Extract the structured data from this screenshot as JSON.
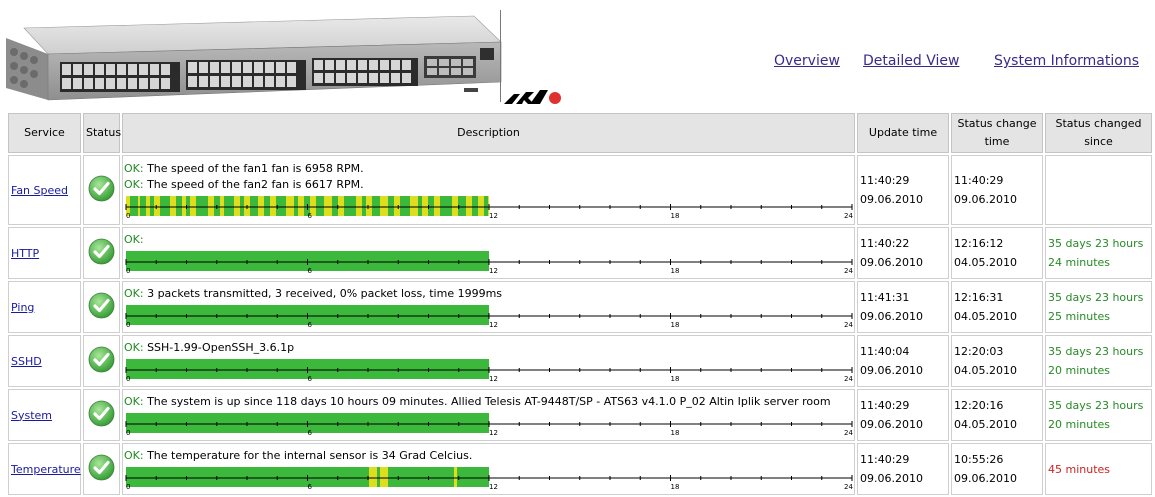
{
  "nav": {
    "overview": "Overview",
    "detailed": "Detailed View",
    "sysinfo": "System Informations"
  },
  "table": {
    "headers": {
      "service": "Service",
      "status": "Status",
      "description": "Description",
      "update": "Update time",
      "change": "Status change time",
      "since": "Status changed since"
    },
    "axis_labels": [
      "0",
      "6",
      "12",
      "18",
      "24"
    ],
    "rows": [
      {
        "service": "Fan Speed",
        "status": "OK",
        "ok": "OK:",
        "desc": [
          " The speed of the fan1 fan is 6958 RPM.",
          " The speed of the fan2 fan is 6617 RPM."
        ],
        "update_time": "11:40:29",
        "update_date": "09.06.2010",
        "change_time": "11:40:29",
        "change_date": "09.06.2010",
        "since_a": "",
        "since_b": "",
        "since_color": "#268a26",
        "bar_fill_hours": 12,
        "bar_pattern": "mixed"
      },
      {
        "service": "HTTP",
        "status": "OK",
        "ok": "OK:",
        "desc": [
          ""
        ],
        "update_time": "11:40:22",
        "update_date": "09.06.2010",
        "change_time": "12:16:12",
        "change_date": "04.05.2010",
        "since_a": "35 days 23 hours",
        "since_b": "24 minutes",
        "since_color": "#268a26",
        "bar_fill_hours": 12,
        "bar_pattern": "green"
      },
      {
        "service": "Ping",
        "status": "OK",
        "ok": "OK:",
        "desc": [
          " 3 packets transmitted, 3 received, 0% packet loss, time 1999ms"
        ],
        "update_time": "11:41:31",
        "update_date": "09.06.2010",
        "change_time": "12:16:31",
        "change_date": "04.05.2010",
        "since_a": "35 days 23 hours",
        "since_b": "25 minutes",
        "since_color": "#268a26",
        "bar_fill_hours": 12,
        "bar_pattern": "green"
      },
      {
        "service": "SSHD",
        "status": "OK",
        "ok": "OK:",
        "desc": [
          " SSH-1.99-OpenSSH_3.6.1p"
        ],
        "update_time": "11:40:04",
        "update_date": "09.06.2010",
        "change_time": "12:20:03",
        "change_date": "04.05.2010",
        "since_a": "35 days 23 hours",
        "since_b": "20 minutes",
        "since_color": "#268a26",
        "bar_fill_hours": 12,
        "bar_pattern": "green"
      },
      {
        "service": "System",
        "status": "OK",
        "ok": "OK:",
        "desc": [
          " The system is up since 118 days 10 hours 09 minutes. Allied Telesis AT-9448T/SP - ATS63 v4.1.0 P_02 Altin Iplik server room"
        ],
        "update_time": "11:40:29",
        "update_date": "09.06.2010",
        "change_time": "12:20:16",
        "change_date": "04.05.2010",
        "since_a": "35 days 23 hours",
        "since_b": "20 minutes",
        "since_color": "#268a26",
        "bar_fill_hours": 12,
        "bar_pattern": "green"
      },
      {
        "service": "Temperature",
        "status": "OK",
        "ok": "OK:",
        "desc": [
          " The temperature for the internal sensor is 34 Grad Celcius."
        ],
        "update_time": "11:40:29",
        "update_date": "09.06.2010",
        "change_time": "10:55:26",
        "change_date": "09.06.2010",
        "since_a": "45 minutes",
        "since_b": "",
        "since_color": "#cc2222",
        "bar_fill_hours": 12,
        "bar_pattern": "temp"
      }
    ]
  },
  "colors": {
    "ok_green": "#238a23",
    "bar_green": "#3cb83c",
    "bar_yellow": "#dede1e",
    "link_purple": "#3c2a8a"
  },
  "icons": {
    "status": "check-circle-icon",
    "device": "network-switch-image",
    "logo": "allied-telesis-logo"
  }
}
